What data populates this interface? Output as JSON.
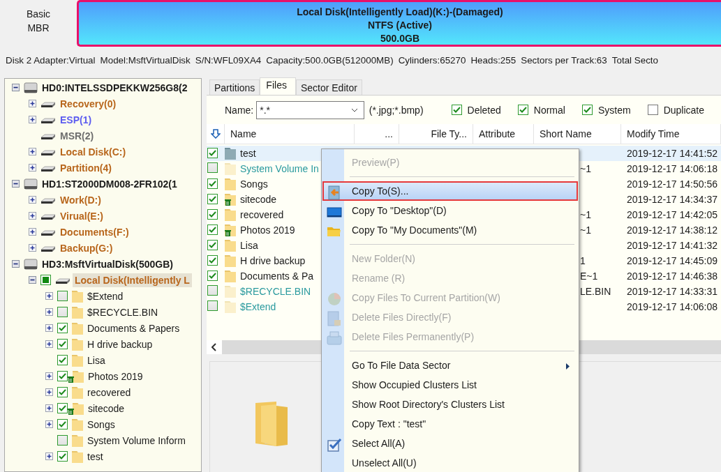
{
  "disk_type": [
    "Basic",
    "MBR"
  ],
  "partition_bar": {
    "lines": [
      "Local Disk(Intelligently Load)(K:)-(Damaged)",
      "NTFS (Active)",
      "500.0GB"
    ]
  },
  "disk_info": [
    "Disk 2 Adapter:Virtual",
    "Model:MsftVirtualDisk",
    "S/N:WFL09XA4",
    "Capacity:500.0GB(512000MB)",
    "Cylinders:65270",
    "Heads:255",
    "Sectors per Track:63",
    "Total Secto"
  ],
  "tree": [
    {
      "kind": "disk",
      "label": "HD0:INTELSSDPEKKW256G8(2",
      "color": "#1a1a1a",
      "expanded": true,
      "selected": false,
      "children": [
        {
          "kind": "partition",
          "label": "Recovery(0)",
          "color": "#b8661c",
          "expanded": false,
          "selected": false
        },
        {
          "kind": "partition",
          "label": "ESP(1)",
          "color": "#5c5cf0",
          "expanded": false,
          "selected": false
        },
        {
          "kind": "partition",
          "label": "MSR(2)",
          "color": "#6e6e6e",
          "selected": false
        },
        {
          "kind": "partition",
          "label": "Local Disk(C:)",
          "color": "#b8661c",
          "expanded": false,
          "selected": false
        },
        {
          "kind": "partition",
          "label": "Partition(4)",
          "color": "#b8661c",
          "expanded": false,
          "selected": false
        }
      ]
    },
    {
      "kind": "disk",
      "label": "HD1:ST2000DM008-2FR102(1",
      "color": "#1a1a1a",
      "expanded": true,
      "selected": false,
      "children": [
        {
          "kind": "partition",
          "label": "Work(D:)",
          "color": "#b8661c",
          "expanded": false,
          "selected": false
        },
        {
          "kind": "partition",
          "label": "Virual(E:)",
          "color": "#b8661c",
          "expanded": false,
          "selected": false
        },
        {
          "kind": "partition",
          "label": "Documents(F:)",
          "color": "#b8661c",
          "expanded": false,
          "selected": false
        },
        {
          "kind": "partition",
          "label": "Backup(G:)",
          "color": "#b8661c",
          "expanded": false,
          "selected": false
        }
      ]
    },
    {
      "kind": "disk",
      "label": "HD3:MsftVirtualDisk(500GB)",
      "color": "#1a1a1a",
      "expanded": true,
      "selected": false,
      "children": [
        {
          "kind": "partition",
          "label": "Local Disk(Intelligently L",
          "color": "#b8661c",
          "expanded": true,
          "selected": true,
          "checked": true,
          "partial": true,
          "children": [
            {
              "kind": "folder",
              "label": "$Extend",
              "color": "#1a1a1a",
              "expanded": false,
              "selected": false,
              "checked": false,
              "deleted": false
            },
            {
              "kind": "folder",
              "label": "$RECYCLE.BIN",
              "color": "#1a1a1a",
              "expanded": false,
              "selected": false,
              "checked": false,
              "deleted": false
            },
            {
              "kind": "folder",
              "label": "Documents & Papers",
              "color": "#1a1a1a",
              "expanded": false,
              "selected": false,
              "checked": true,
              "deleted": false
            },
            {
              "kind": "folder",
              "label": "H drive backup",
              "color": "#1a1a1a",
              "expanded": false,
              "selected": false,
              "checked": true,
              "deleted": false
            },
            {
              "kind": "folder",
              "label": "Lisa",
              "color": "#1a1a1a",
              "selected": false,
              "checked": true,
              "deleted": false
            },
            {
              "kind": "folder",
              "label": "Photos 2019",
              "color": "#1a1a1a",
              "expanded": false,
              "selected": false,
              "checked": true,
              "deleted": true
            },
            {
              "kind": "folder",
              "label": "recovered",
              "color": "#1a1a1a",
              "expanded": false,
              "selected": false,
              "checked": true,
              "deleted": false
            },
            {
              "kind": "folder",
              "label": "sitecode",
              "color": "#1a1a1a",
              "expanded": false,
              "selected": false,
              "checked": true,
              "deleted": true
            },
            {
              "kind": "folder",
              "label": "Songs",
              "color": "#1a1a1a",
              "expanded": false,
              "selected": false,
              "checked": true,
              "deleted": false
            },
            {
              "kind": "folder",
              "label": "System Volume Inform",
              "color": "#1a1a1a",
              "selected": false,
              "checked": false,
              "deleted": false
            },
            {
              "kind": "folder",
              "label": "test",
              "color": "#1a1a1a",
              "expanded": false,
              "selected": false,
              "checked": true,
              "deleted": false
            }
          ]
        }
      ]
    }
  ],
  "tabs": [
    {
      "label": "Partitions",
      "selected": false
    },
    {
      "label": "Files",
      "selected": true
    },
    {
      "label": "Sector Editor",
      "selected": false
    }
  ],
  "filter": {
    "label": "Name:",
    "value": "*.*",
    "hint": "(*.jpg;*.bmp)",
    "options": [
      {
        "label": "Deleted",
        "checked": true
      },
      {
        "label": "Normal",
        "checked": true
      },
      {
        "label": "System",
        "checked": true
      },
      {
        "label": "Duplicate",
        "checked": false
      }
    ]
  },
  "table": {
    "columns": [
      "Name",
      "...",
      "File Ty...",
      "Attribute",
      "Short Name",
      "Modify Time"
    ],
    "rows": [
      {
        "kind": "folder",
        "name": "test",
        "checked": true,
        "selected": true,
        "deleted": false,
        "color": "#1a1a1a",
        "modify_time": "2019-12-17 14:41:52"
      },
      {
        "kind": "system",
        "name": "System Volume In",
        "checked": false,
        "selected": false,
        "deleted": false,
        "color": "#2a9a9e",
        "short_name": "~1",
        "modify_time": "2019-12-17 14:06:18"
      },
      {
        "kind": "folder",
        "name": "Songs",
        "checked": true,
        "selected": false,
        "deleted": false,
        "color": "#1a1a1a",
        "modify_time": "2019-12-17 14:50:56"
      },
      {
        "kind": "folder",
        "name": "sitecode",
        "checked": true,
        "selected": false,
        "deleted": true,
        "color": "#1a1a1a",
        "modify_time": "2019-12-17 14:34:37"
      },
      {
        "kind": "folder",
        "name": "recovered",
        "checked": true,
        "selected": false,
        "deleted": false,
        "color": "#1a1a1a",
        "short_name": "~1",
        "modify_time": "2019-12-17 14:42:05"
      },
      {
        "kind": "folder",
        "name": "Photos 2019",
        "checked": true,
        "selected": false,
        "deleted": true,
        "color": "#1a1a1a",
        "short_name": "~1",
        "modify_time": "2019-12-17 14:38:12"
      },
      {
        "kind": "folder",
        "name": "Lisa",
        "checked": true,
        "selected": false,
        "deleted": false,
        "color": "#1a1a1a",
        "modify_time": "2019-12-17 14:41:32"
      },
      {
        "kind": "folder",
        "name": "H drive backup",
        "checked": true,
        "selected": false,
        "deleted": false,
        "color": "#1a1a1a",
        "short_name": "1",
        "modify_time": "2019-12-17 14:45:09"
      },
      {
        "kind": "folder",
        "name": "Documents & Pa",
        "checked": true,
        "selected": false,
        "deleted": false,
        "color": "#1a1a1a",
        "short_name": "E~1",
        "modify_time": "2019-12-17 14:46:38"
      },
      {
        "kind": "system",
        "name": "$RECYCLE.BIN",
        "checked": false,
        "selected": false,
        "deleted": false,
        "color": "#2a9a9e",
        "short_name": "LE.BIN",
        "modify_time": "2019-12-17 14:33:31"
      },
      {
        "kind": "system",
        "name": "$Extend",
        "checked": false,
        "selected": false,
        "deleted": false,
        "color": "#2a9a9e",
        "modify_time": "2019-12-17 14:06:08"
      }
    ]
  },
  "context_menu": {
    "items": [
      {
        "kind": "item",
        "label": "Preview(P)",
        "disabled": true,
        "selected": false,
        "submenu": false
      },
      {
        "kind": "separator"
      },
      {
        "kind": "item",
        "label": "Copy To(S)...",
        "disabled": false,
        "selected": true,
        "submenu": false
      },
      {
        "kind": "item",
        "label": "Copy To \"Desktop\"(D)",
        "disabled": false,
        "selected": false,
        "submenu": false
      },
      {
        "kind": "item",
        "label": "Copy To \"My Documents\"(M)",
        "disabled": false,
        "selected": false,
        "submenu": false
      },
      {
        "kind": "separator"
      },
      {
        "kind": "item",
        "label": "New Folder(N)",
        "disabled": true,
        "selected": false,
        "submenu": false
      },
      {
        "kind": "item",
        "label": "Rename (R)",
        "disabled": true,
        "selected": false,
        "submenu": false
      },
      {
        "kind": "item",
        "label": "Copy Files To Current Partition(W)",
        "disabled": true,
        "selected": false,
        "submenu": false
      },
      {
        "kind": "item",
        "label": "Delete Files Directly(F)",
        "disabled": true,
        "selected": false,
        "submenu": false
      },
      {
        "kind": "item",
        "label": "Delete Files Permanently(P)",
        "disabled": true,
        "selected": false,
        "submenu": false
      },
      {
        "kind": "separator"
      },
      {
        "kind": "item",
        "label": "Go To File Data Sector",
        "disabled": false,
        "selected": false,
        "submenu": true
      },
      {
        "kind": "item",
        "label": "Show Occupied Clusters List",
        "disabled": false,
        "selected": false,
        "submenu": false
      },
      {
        "kind": "item",
        "label": "Show Root Directory's Clusters List",
        "disabled": false,
        "selected": false,
        "submenu": false
      },
      {
        "kind": "item",
        "label": "Copy Text : \"test\"",
        "disabled": false,
        "selected": false,
        "submenu": false
      },
      {
        "kind": "item",
        "label": "Select All(A)",
        "disabled": false,
        "selected": false,
        "submenu": false
      },
      {
        "kind": "item",
        "label": "Unselect All(U)",
        "disabled": false,
        "selected": false,
        "submenu": false
      }
    ]
  }
}
